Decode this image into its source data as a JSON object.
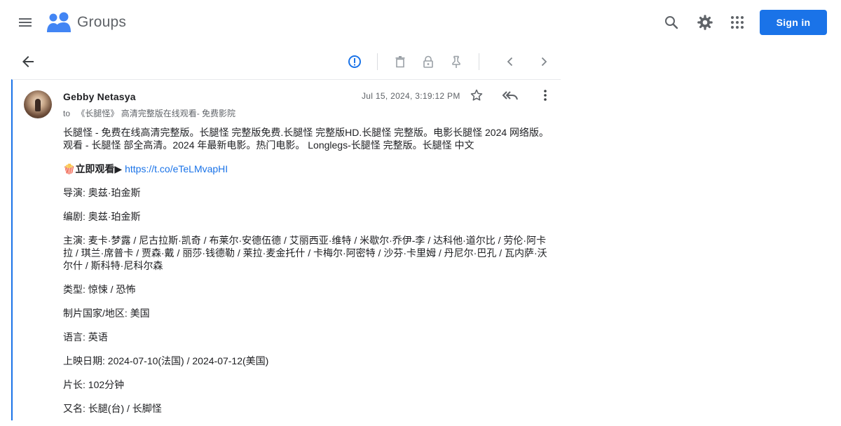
{
  "header": {
    "app_name": "Groups",
    "signin_label": "Sign in",
    "icons": [
      "menu-icon",
      "groups-logo",
      "search-icon",
      "gear-icon",
      "apps-grid-icon"
    ]
  },
  "toolbar": {
    "icons": [
      "back-arrow-icon",
      "report-icon",
      "delete-icon",
      "lock-icon",
      "pin-icon",
      "chevron-left-icon",
      "chevron-right-icon"
    ]
  },
  "message": {
    "sender": "Gebby Netasya",
    "to_label": "to",
    "to_group": "《长腿怪》 高清完整版在线观看- 免费影院",
    "timestamp": "Jul 15, 2024, 3:19:12 PM",
    "paragraph_1": "长腿怪 - 免费在线高清完整版。长腿怪 完整版免费.长腿怪 完整版HD.长腿怪 完整版。电影长腿怪 2024 网络版。观看 - 长腿怪 部全高清。2024 年最新电影。热门电影。 Longlegs-长腿怪 完整版。长腿怪 中文",
    "watch_emoji": "🍿",
    "watch_label": "立即观看▶",
    "watch_link": "https://t.co/eTeLMvapHI",
    "director": "导演: 奥兹·珀金斯",
    "writer": "编剧: 奥兹·珀金斯",
    "cast": "主演: 麦卡·梦露 / 尼古拉斯·凯奇 / 布莱尔·安德伍德 / 艾丽西亚·维特 / 米歇尔·乔伊-李 / 达科他·道尔比 / 劳伦·阿卡拉 / 琪兰·席普卡 / 贾森·戴 / 丽莎·钱德勒 / 莱拉·麦金托什 / 卡梅尔·阿密特 / 沙芬·卡里姆 / 丹尼尔·巴孔 / 瓦内萨·沃尔什 / 斯科特·尼科尔森",
    "genre": "类型: 惊悚 / 恐怖",
    "country": "制片国家/地区: 美国",
    "language": "语言: 英语",
    "release": "上映日期: 2024-07-10(法国) / 2024-07-12(美国)",
    "runtime": "片长: 102分钟",
    "aka": "又名: 长腿(台) / 长脚怪"
  },
  "colors": {
    "accent": "#1a73e8",
    "text": "#202124",
    "muted": "#5f6368"
  }
}
